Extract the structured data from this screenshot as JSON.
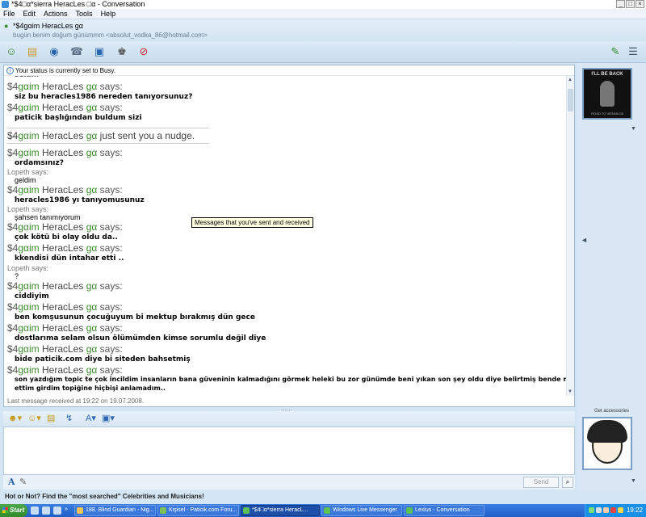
{
  "window": {
    "title": "*$4□α*sierra HeracLes □α - Conversation",
    "controls": [
      "_",
      "□",
      "×"
    ]
  },
  "menu": [
    "File",
    "Edit",
    "Actions",
    "Tools",
    "Help"
  ],
  "contact": {
    "name": "*$4ɡαim HeracLes ɡα",
    "personal_message": "bugün benim doğum günümmm  <absolut_vodka_86@hotmail.com>"
  },
  "status_strip": "Your status is currently set to Busy.",
  "conversation": {
    "partial_top": "selam",
    "messages": [
      {
        "sender": "heracles",
        "text": "siz bu heracles1986 nereden tanıyorsunuz?"
      },
      {
        "sender": "heracles",
        "text": "paticik başlığından buldum sizi"
      },
      {
        "sender": "nudge",
        "text": "just sent you a nudge."
      },
      {
        "sender": "heracles",
        "text": "ordamsınız?"
      },
      {
        "sender": "lopeth",
        "text": "geldim"
      },
      {
        "sender": "heracles",
        "text": "heracles1986 yı tanıyomusunuz"
      },
      {
        "sender": "lopeth",
        "text": "şahsen tanımıyorum"
      },
      {
        "sender": "heracles",
        "text": "çok kötü bi olay oldu da.."
      },
      {
        "sender": "heracles",
        "text": "kkendisi dün intahar etti .."
      },
      {
        "sender": "lopeth",
        "text": "?"
      },
      {
        "sender": "heracles",
        "text": "ciddiyim"
      },
      {
        "sender": "heracles",
        "text": "ben komşusunun çocuğuyum bi mektup bırakmış dün gece"
      },
      {
        "sender": "heracles",
        "text": "dostlarıma selam olsun ölümümden kimse sorumlu değil diye"
      },
      {
        "sender": "heracles",
        "text": "bide paticik.com diye bi siteden bahsetmiş"
      },
      {
        "sender": "heracles",
        "text": "son yazdığım topic te çok incildim insanların bana güveninin kalmadığını görmek heleki bu zor günümde beni yıkan son şey oldu diye belirtmiş bende merak",
        "text2": "ettim girdim topiğine hiçbişi anlamadım.."
      }
    ],
    "heracles_prefix": "$4",
    "heracles_glyph": "ɡα",
    "heracles_im": "im",
    "heracles_name": "HeracLes",
    "heracles_tail": "ɡα",
    "says": "says:",
    "lopeth_header": "Lopeth says:",
    "last_message": "Last message received at 19:22 on 19.07.2008."
  },
  "tooltip": "Messages that you've sent and received",
  "input": {
    "send_label": "Send",
    "search_label": "⌕"
  },
  "right_panel": {
    "pic1_text": "I'LL BE BACK",
    "pic1_bottom": "ROAD TO VIENNA 08",
    "accessories": "Get accessories"
  },
  "ad": "Hot or Not? Find the \"most searched\" Celebrities and Musicians!",
  "taskbar": {
    "start": "Start",
    "tasks": [
      {
        "label": "188. Blind Guardian - Nig..."
      },
      {
        "label": "Kişisel - Paticik.com Foru..."
      },
      {
        "label": "*$4□α*sierra HeracL..."
      },
      {
        "label": "Windows Live Messenger"
      },
      {
        "label": "Lexius - Conversation"
      }
    ],
    "clock": "19:22"
  }
}
